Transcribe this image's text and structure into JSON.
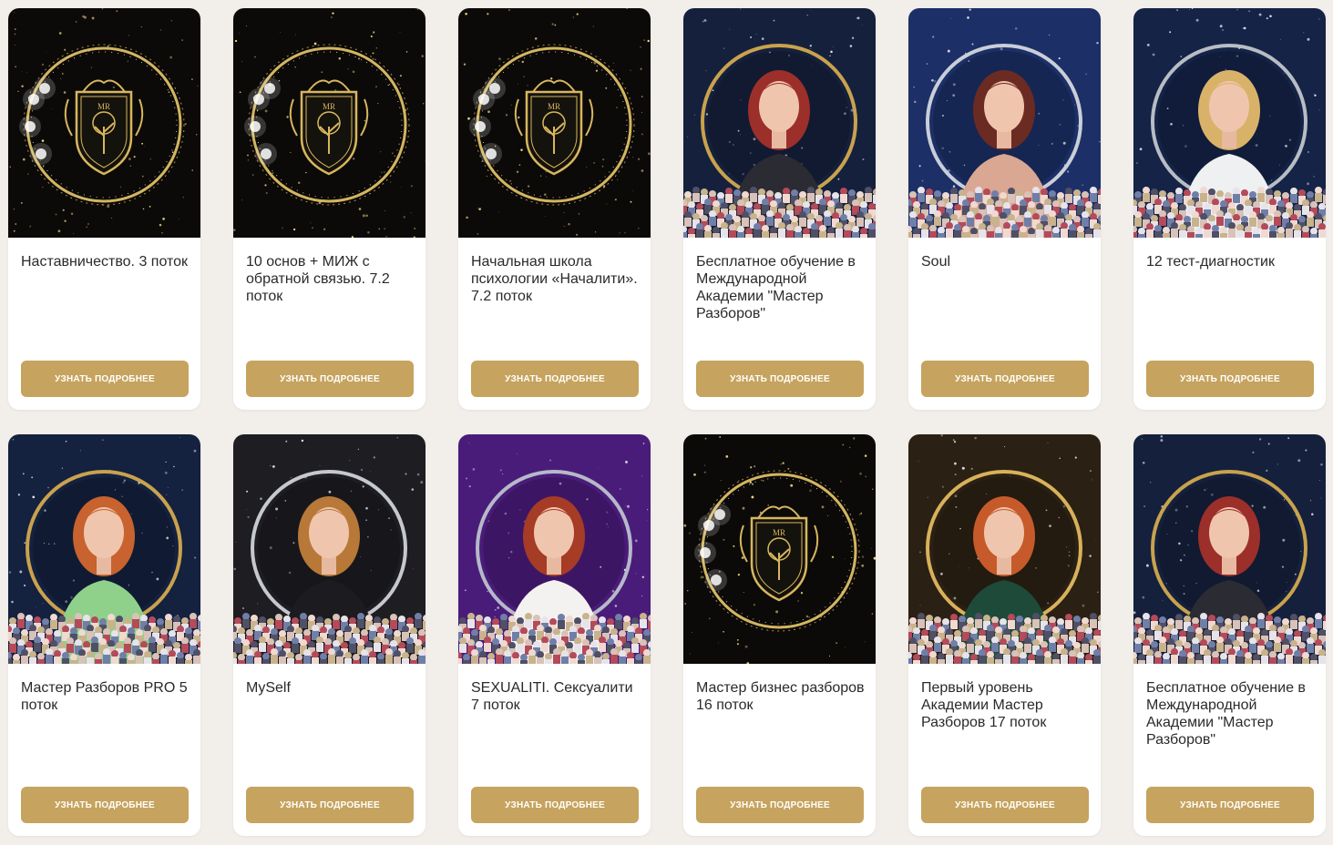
{
  "button_label": "УЗНАТЬ ПОДРОБНЕЕ",
  "colors": {
    "page_bg": "#f2efeb",
    "card_bg": "#ffffff",
    "accent_gold": "#c6a35e",
    "text": "#2a2a2a"
  },
  "logo_text": "MR",
  "cards": [
    {
      "title": "Наставничество. 3 поток",
      "cover": "logo-gold-ring",
      "bg": "#0b0a08",
      "ring": "#e9c86b"
    },
    {
      "title": "10 основ + МИЖ с обратной связью. 7.2 поток",
      "cover": "logo-gold-ring",
      "bg": "#0b0a08",
      "ring": "#e9c86b"
    },
    {
      "title": "Начальная школа психологии «Началити». 7.2 поток",
      "cover": "logo-gold-ring",
      "bg": "#0b0a08",
      "ring": "#e9c86b"
    },
    {
      "title": "Бесплатное обучение в Международной Академии \"Мастер Разборов\"",
      "cover": "portrait-audience",
      "bg": "#15203c",
      "ring": "#c9a24d",
      "hair": "#9c2f2a",
      "outfit": "#2b2b33"
    },
    {
      "title": "Soul",
      "cover": "portrait-audience",
      "bg": "#1c2f66",
      "ring": "#c9ced8",
      "hair": "#6b2b22",
      "outfit": "#d9a792"
    },
    {
      "title": "12 тест-диагностик",
      "cover": "portrait-audience",
      "bg": "#142346",
      "ring": "#b8bcc4",
      "hair": "#d9b26a",
      "outfit": "#eef0f2"
    },
    {
      "title": "Мастер Разборов PRO 5 поток",
      "cover": "portrait-audience",
      "bg": "#14213f",
      "ring": "#c9a24d",
      "hair": "#c8622e",
      "outfit": "#8fd18a"
    },
    {
      "title": "MySelf",
      "cover": "portrait-audience",
      "bg": "#1d1d22",
      "ring": "#c5c8cc",
      "hair": "#b87838",
      "outfit": "#1c1c20"
    },
    {
      "title": "SEXUALITI. Сексуалити 7 поток",
      "cover": "portrait-audience",
      "bg": "#4a1c7a",
      "ring": "#b6b9c8",
      "hair": "#a63b26",
      "outfit": "#f4f2f0"
    },
    {
      "title": "Мастер бизнес разборов 16 поток",
      "cover": "logo-gold-ring",
      "bg": "#0b0a08",
      "ring": "#e9c86b"
    },
    {
      "title": "Первый уровень Академии Мастер Разборов 17 поток",
      "cover": "portrait-audience",
      "bg": "#2b2014",
      "ring": "#d8b25a",
      "hair": "#c65a2a",
      "outfit": "#1e4a3a"
    },
    {
      "title": "Бесплатное обучение в Международной Академии \"Мастер Разборов\"",
      "cover": "portrait-audience",
      "bg": "#15203c",
      "ring": "#c9a24d",
      "hair": "#9c2f2a",
      "outfit": "#2b2b33"
    }
  ]
}
